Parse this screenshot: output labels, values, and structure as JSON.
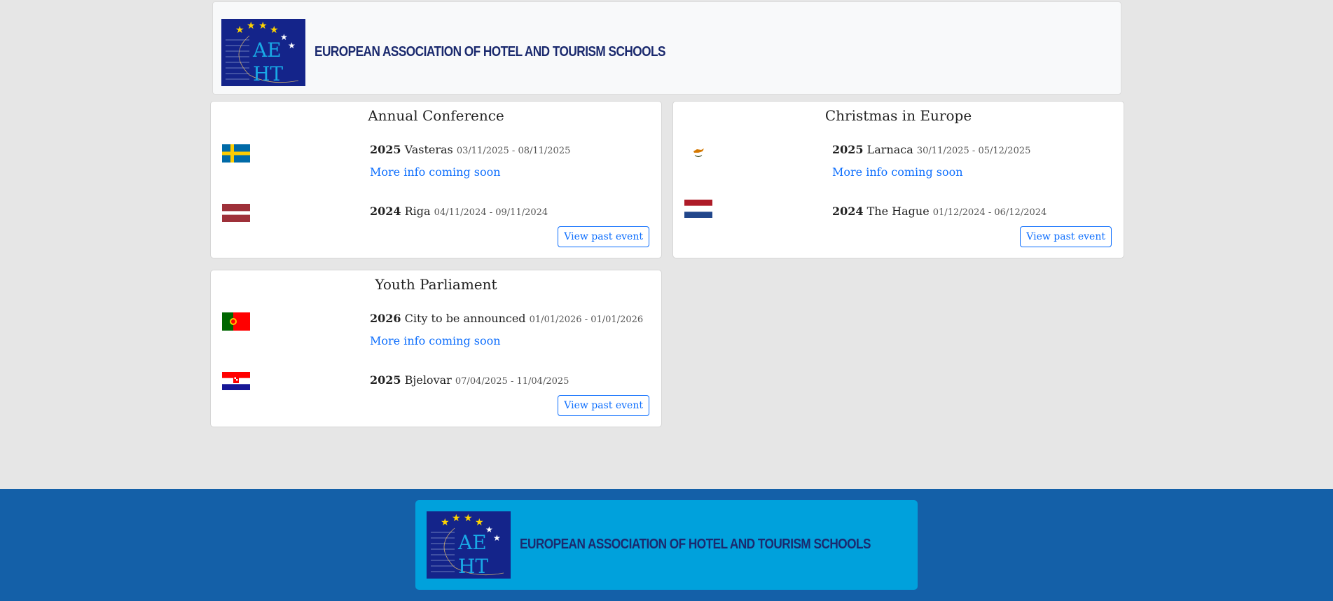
{
  "header": {
    "logo_text": "AE HT",
    "org_name": "EUROPEAN ASSOCIATION OF HOTEL AND TOURISM SCHOOLS"
  },
  "cards": [
    {
      "title": "Annual Conference",
      "events": [
        {
          "flag": "sweden-flag",
          "year": "2025",
          "city": "Vasteras",
          "dates": "03/11/2025 - 08/11/2025",
          "more": "More info coming soon"
        },
        {
          "flag": "latvia-flag",
          "year": "2024",
          "city": "Riga",
          "dates": "04/11/2024 - 09/11/2024"
        }
      ],
      "button": "View past event"
    },
    {
      "title": "Christmas in Europe",
      "events": [
        {
          "flag": "cyprus-flag",
          "year": "2025",
          "city": "Larnaca",
          "dates": "30/11/2025 - 05/12/2025",
          "more": "More info coming soon"
        },
        {
          "flag": "netherlands-flag",
          "year": "2024",
          "city": "The Hague",
          "dates": "01/12/2024 - 06/12/2024"
        }
      ],
      "button": "View past event"
    },
    {
      "title": "Youth Parliament",
      "events": [
        {
          "flag": "portugal-flag",
          "year": "2026",
          "city": "City to be announced",
          "dates": "01/01/2026 - 01/01/2026",
          "more": "More info coming soon"
        },
        {
          "flag": "croatia-flag",
          "year": "2025",
          "city": "Bjelovar",
          "dates": "07/04/2025 - 11/04/2025"
        }
      ],
      "button": "View past event"
    }
  ],
  "footer": {
    "logo_text": "AE HT",
    "org_name": "EUROPEAN ASSOCIATION OF HOTEL AND TOURISM SCHOOLS"
  },
  "colors": {
    "page_bg": "#e6e6e6",
    "link": "#0d6efd",
    "footer_bg": "#1460a8",
    "footer_panel": "#00a1dc",
    "brand_navy": "#1b2a6e"
  }
}
